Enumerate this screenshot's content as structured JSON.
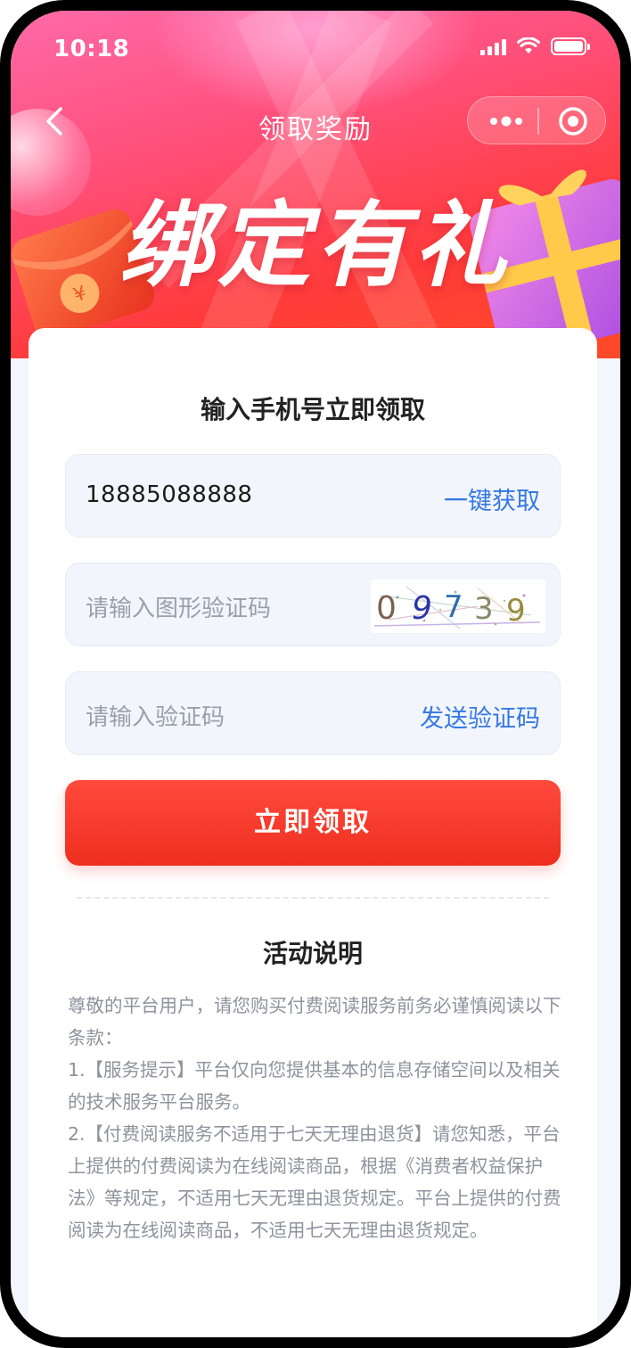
{
  "status_bar": {
    "time": "10:18"
  },
  "nav": {
    "title": "领取奖励"
  },
  "banner": {
    "headline": "绑定有礼"
  },
  "form": {
    "title": "输入手机号立即领取",
    "phone_value": "18885088888",
    "phone_action": "一键获取",
    "captcha_placeholder": "请输入图形验证码",
    "captcha_chars": [
      "0",
      "9",
      "7",
      "3",
      "9"
    ],
    "sms_placeholder": "请输入验证码",
    "sms_action": "发送验证码",
    "submit_label": "立即领取"
  },
  "activity": {
    "title": "活动说明",
    "paragraphs": [
      "尊敬的平台用户，请您购买付费阅读服务前务必谨慎阅读以下条款：",
      "1.【服务提示】平台仅向您提供基本的信息存储空间以及相关的技术服务平台服务。",
      "2.【付费阅读服务不适用于七天无理由退货】请您知悉，平台上提供的付费阅读为在线阅读商品，根据《消费者权益保护法》等规定，不适用七天无理由退货规定。平台上提供的付费阅读为在线阅读商品，不适用七天无理由退货规定。"
    ]
  },
  "colors": {
    "accent_blue": "#3577e5",
    "button_red": "#ee2e1e",
    "banner_pink": "#ff5a8c"
  },
  "icons": [
    "back-chevron-icon",
    "more-dots-icon",
    "close-target-icon",
    "signal-icon",
    "wifi-icon",
    "battery-icon"
  ]
}
